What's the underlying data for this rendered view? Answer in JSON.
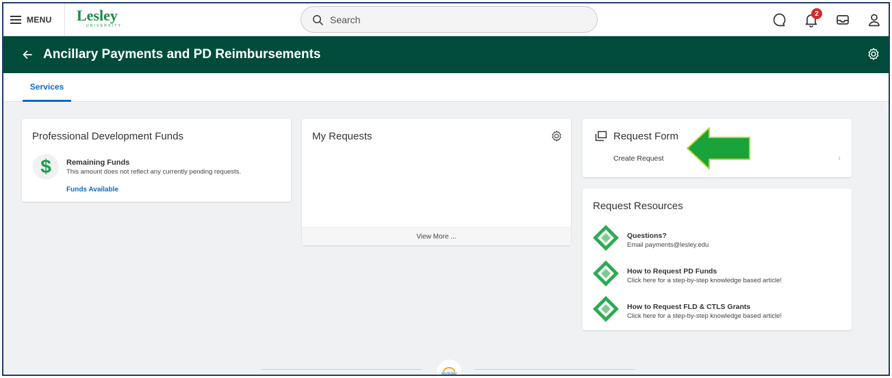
{
  "topbar": {
    "menu_label": "MENU",
    "logo": {
      "name": "Lesley",
      "sub": "UNIVERSITY"
    },
    "search_placeholder": "Search",
    "notification_count": "2",
    "icons": [
      "chat-icon",
      "bell-icon",
      "inbox-icon",
      "user-icon"
    ]
  },
  "header": {
    "title": "Ancillary Payments and PD Reimbursements",
    "bg_color": "#004b3a"
  },
  "tabs": [
    {
      "label": "Services",
      "active": true
    }
  ],
  "pd_card": {
    "title": "Professional Development Funds",
    "item_title": "Remaining Funds",
    "item_desc": "This amount does not reflect any currently pending requests.",
    "link": "Funds Available"
  },
  "requests_card": {
    "title": "My Requests",
    "view_more": "View More ..."
  },
  "form_card": {
    "title": "Request Form",
    "action": "Create Request"
  },
  "resources_card": {
    "title": "Request Resources",
    "items": [
      {
        "title": "Questions?",
        "desc": "Email payments@lesley.edu"
      },
      {
        "title": "How to Request PD Funds",
        "desc": "Click here for a step-by-step knowledge based article!"
      },
      {
        "title": "How to Request FLD & CTLS Grants",
        "desc": "Click here for a step-by-step knowledge based article!"
      }
    ]
  },
  "footer": {
    "brand": "workday"
  },
  "colors": {
    "accent": "#0b6bc5",
    "brand_green": "#1b8a45",
    "arrow_green": "#1aa33a",
    "badge": "#d52b2b"
  }
}
